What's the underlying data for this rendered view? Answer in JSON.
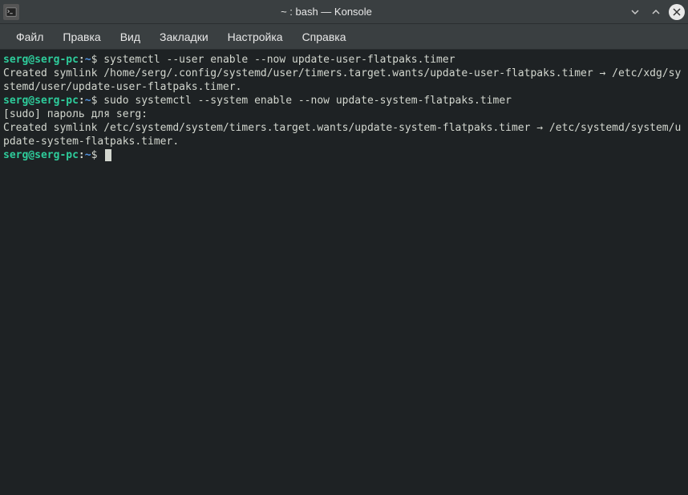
{
  "window": {
    "title": "~ : bash — Konsole"
  },
  "menubar": {
    "items": [
      "Файл",
      "Правка",
      "Вид",
      "Закладки",
      "Настройка",
      "Справка"
    ]
  },
  "prompt": {
    "user_host": "serg@serg-pc",
    "colon": ":",
    "path": "~",
    "symbol": "$"
  },
  "lines": {
    "cmd1": " systemctl --user enable --now update-user-flatpaks.timer",
    "out1": "Created symlink /home/serg/.config/systemd/user/timers.target.wants/update-user-flatpaks.timer → /etc/xdg/systemd/user/update-user-flatpaks.timer.",
    "cmd2": " sudo systemctl --system enable --now update-system-flatpaks.timer",
    "out2a": "[sudo] пароль для serg:",
    "out2b": "Created symlink /etc/systemd/system/timers.target.wants/update-system-flatpaks.timer → /etc/systemd/system/update-system-flatpaks.timer."
  }
}
